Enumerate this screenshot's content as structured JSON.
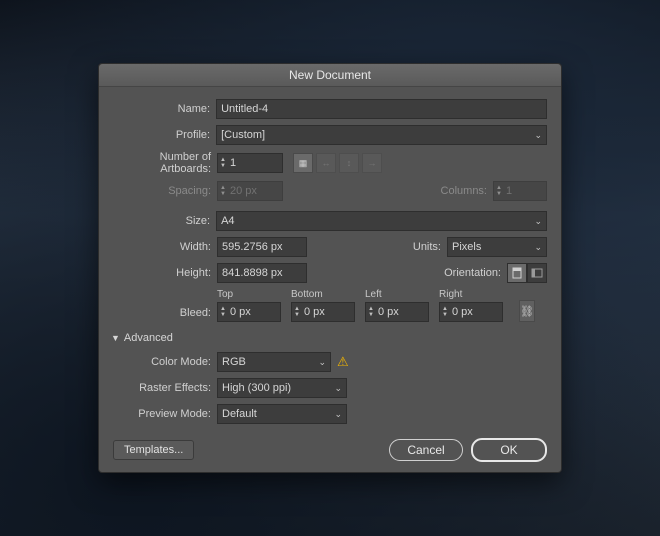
{
  "title": "New Document",
  "labels": {
    "name": "Name:",
    "profile": "Profile:",
    "artboards": "Number of Artboards:",
    "spacing": "Spacing:",
    "columns": "Columns:",
    "size": "Size:",
    "width": "Width:",
    "height": "Height:",
    "units": "Units:",
    "orientation": "Orientation:",
    "bleed": "Bleed:",
    "top": "Top",
    "bottom": "Bottom",
    "left": "Left",
    "right": "Right",
    "advanced": "Advanced",
    "color_mode": "Color Mode:",
    "raster": "Raster Effects:",
    "preview": "Preview Mode:"
  },
  "values": {
    "name": "Untitled-4",
    "profile": "[Custom]",
    "artboards": "1",
    "spacing": "20 px",
    "columns": "1",
    "size": "A4",
    "width": "595.2756 px",
    "height": "841.8898 px",
    "units": "Pixels",
    "bleed_top": "0 px",
    "bleed_bottom": "0 px",
    "bleed_left": "0 px",
    "bleed_right": "0 px",
    "color_mode": "RGB",
    "raster": "High (300 ppi)",
    "preview": "Default"
  },
  "buttons": {
    "templates": "Templates...",
    "cancel": "Cancel",
    "ok": "OK"
  },
  "icons": {
    "grid": "grid-icon",
    "arrows_lr": "arrows-lr-icon",
    "arrow_up": "arrow-up-icon",
    "arrow_right": "arrow-right-icon",
    "portrait": "portrait-icon",
    "landscape": "landscape-icon",
    "link": "link-bleed-icon",
    "warning": "warning-icon"
  }
}
